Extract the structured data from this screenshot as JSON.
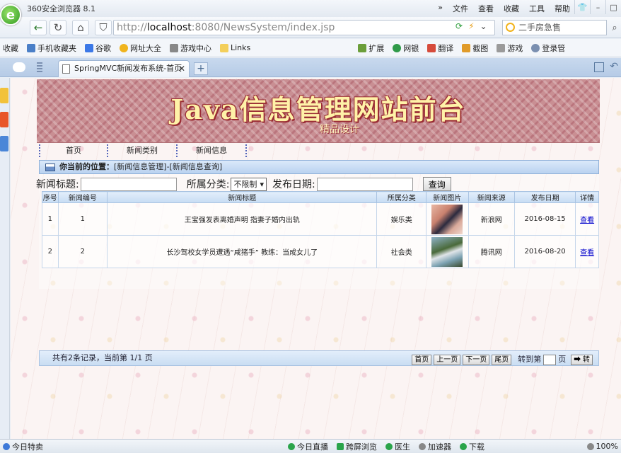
{
  "browser": {
    "title": "360安全浏览器 8.1",
    "menu": [
      "文件",
      "查看",
      "收藏",
      "工具",
      "帮助"
    ],
    "url_scheme": "http://",
    "url_host": "localhost",
    "url_rest": ":8080/NewsSystem/index.jsp",
    "search_placeholder": "二手房急售",
    "bookmarks": [
      "收藏",
      "手机收藏夹",
      "谷歌",
      "网址大全",
      "游戏中心",
      "Links",
      "扩展",
      "网银",
      "翻译",
      "截图",
      "游戏",
      "登录管"
    ],
    "tab_title": "SpringMVC新闻发布系统-首页",
    "status_left": "今日特卖",
    "status_items": [
      "今日直播",
      "跨屏浏览",
      "医生",
      "加速器",
      "下载"
    ],
    "zoom": "100%"
  },
  "site": {
    "banner_title": "Java信息管理网站前台",
    "banner_subtitle": "精品设计",
    "nav": [
      "首页",
      "新闻类别",
      "新闻信息"
    ],
    "location_label": "你当前的位置：",
    "location_path": "[新闻信息管理]-[新闻信息查询]"
  },
  "search": {
    "title_label": "新闻标题:",
    "category_label": "所属分类:",
    "category_value": "不限制",
    "date_label": "发布日期:",
    "button": "查询"
  },
  "table": {
    "headers": [
      "序号",
      "新闻编号",
      "新闻标题",
      "所属分类",
      "新闻图片",
      "新闻来源",
      "发布日期",
      "详情"
    ],
    "rows": [
      {
        "seq": "1",
        "id": "1",
        "title": "王宝强发表离婚声明 指妻子婚内出轨",
        "category": "娱乐类",
        "source": "新浪网",
        "date": "2016-08-15",
        "detail": "查看"
      },
      {
        "seq": "2",
        "id": "2",
        "title": "长沙驾校女学员遭遇“咸猪手” 教练：当成女儿了",
        "category": "社会类",
        "source": "腾讯网",
        "date": "2016-08-20",
        "detail": "查看"
      }
    ]
  },
  "pager": {
    "summary": "共有2条记录，当前第 1/1 页",
    "first": "首页",
    "prev": "上一页",
    "next": "下一页",
    "last": "尾页",
    "goto_label": "转到第",
    "page_unit": "页",
    "go": "➡ 转"
  }
}
